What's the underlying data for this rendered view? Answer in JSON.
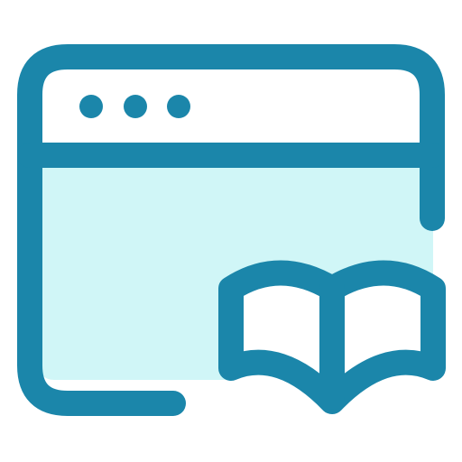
{
  "icon": {
    "name": "browser-window-with-open-book",
    "colors": {
      "stroke": "#1B86AA",
      "content_fill": "#D0F6F7",
      "background": "#FFFFFF"
    },
    "window_dots_count": 3
  }
}
